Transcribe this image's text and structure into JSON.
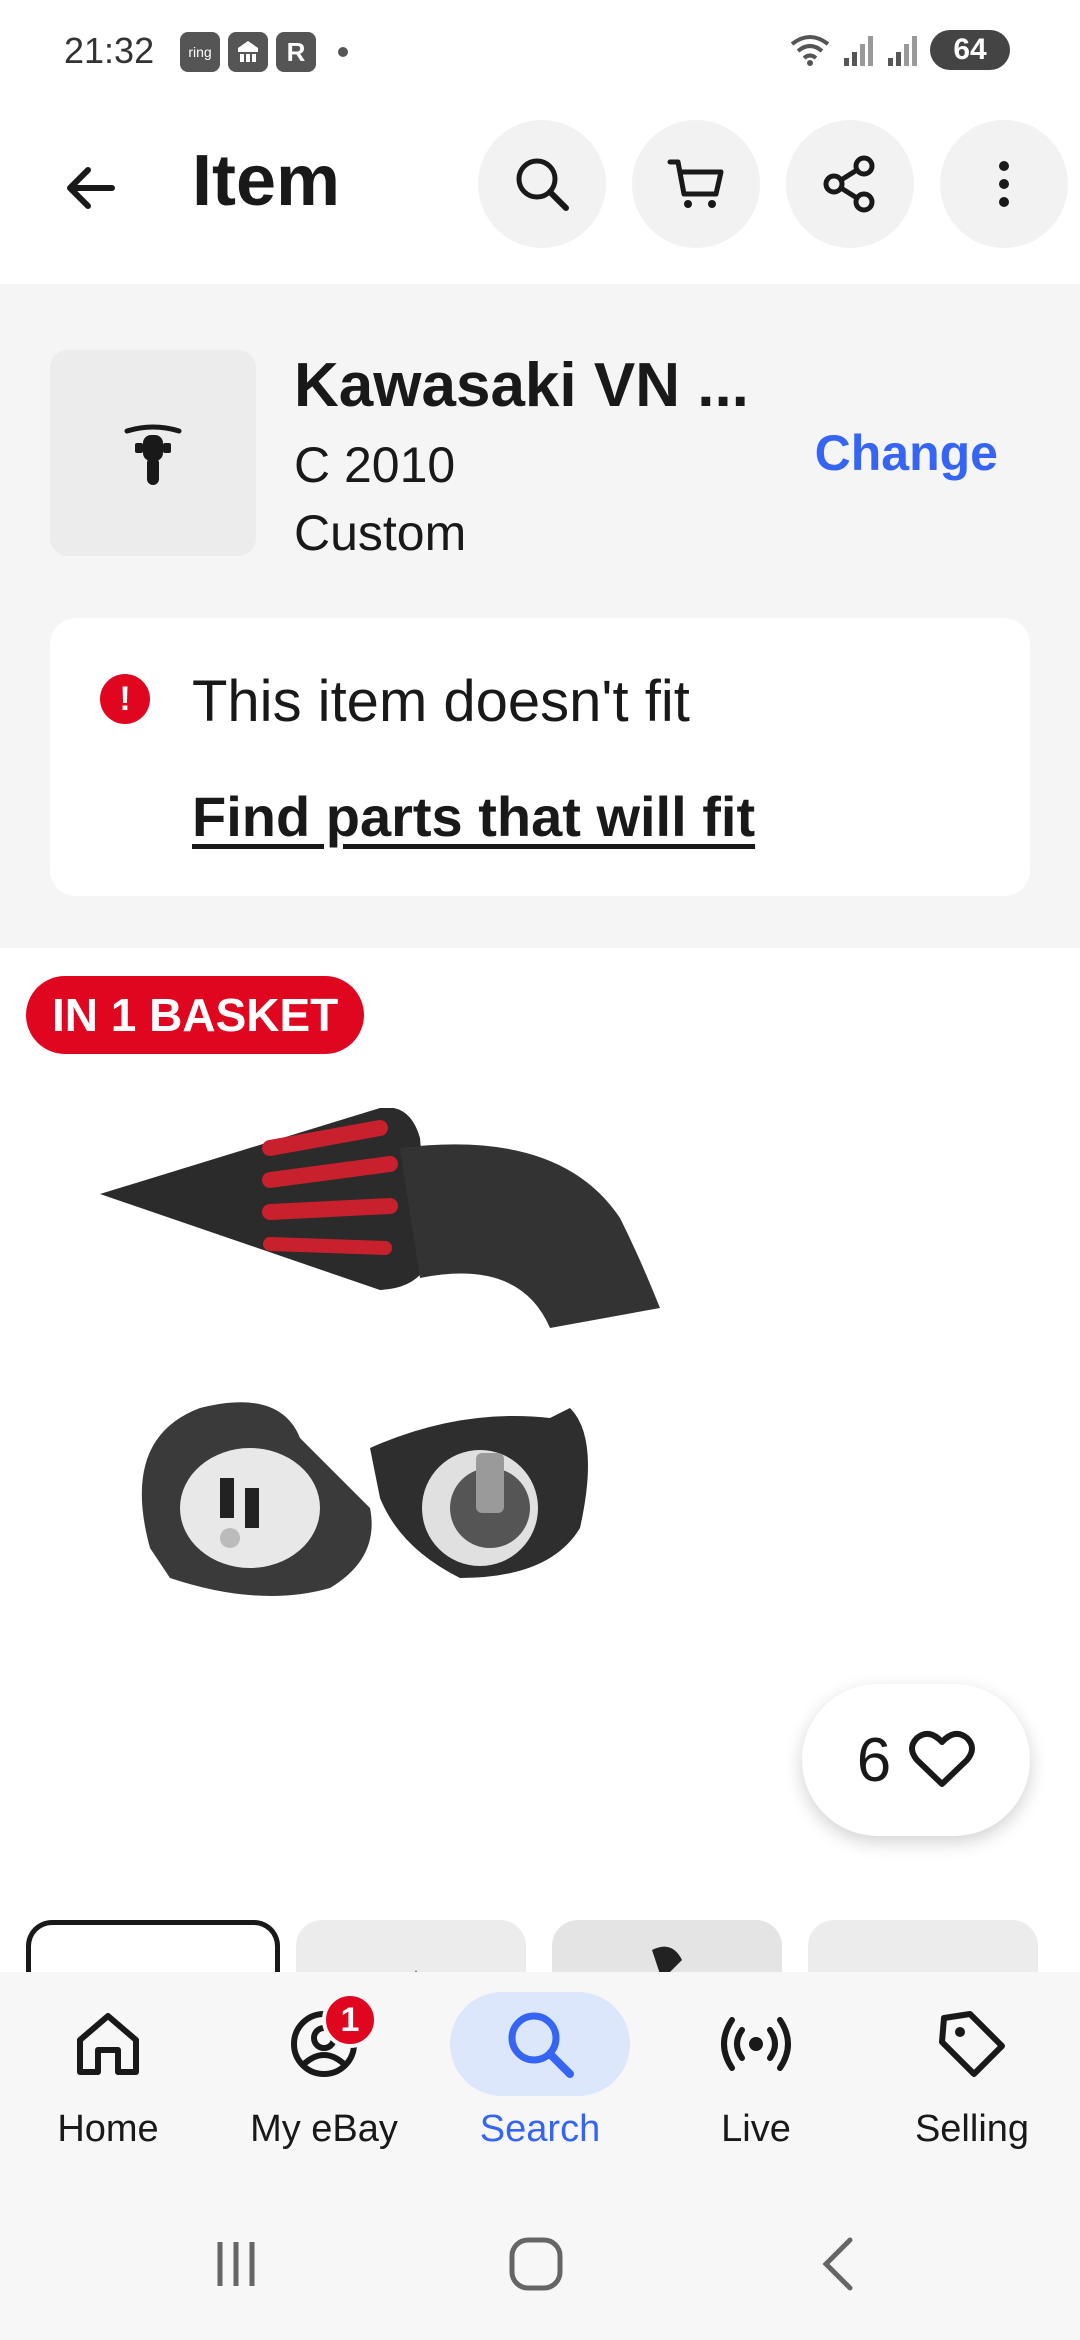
{
  "status_bar": {
    "time": "21:32",
    "notification_icons": [
      "ring",
      "bank-icon",
      "r-icon"
    ],
    "battery": "64"
  },
  "app_bar": {
    "title": "Item"
  },
  "vehicle": {
    "name": "Kawasaki VN ...",
    "year_line": "C 2010",
    "type_line": "Custom",
    "change_label": "Change"
  },
  "fitment": {
    "message": "This item doesn't fit",
    "link": "Find parts that will fit"
  },
  "listing": {
    "basket_badge": "IN 1 BASKET",
    "watch_count": "6"
  },
  "bottom_nav": {
    "items": [
      {
        "label": "Home",
        "icon": "home-icon"
      },
      {
        "label": "My eBay",
        "icon": "account-icon",
        "badge": "1"
      },
      {
        "label": "Search",
        "icon": "search-icon",
        "active": true
      },
      {
        "label": "Live",
        "icon": "live-icon"
      },
      {
        "label": "Selling",
        "icon": "tag-icon"
      }
    ]
  },
  "colors": {
    "accent": "#3665f3",
    "alert": "#e0061f",
    "text": "#191919",
    "section_bg": "#f5f5f5"
  }
}
